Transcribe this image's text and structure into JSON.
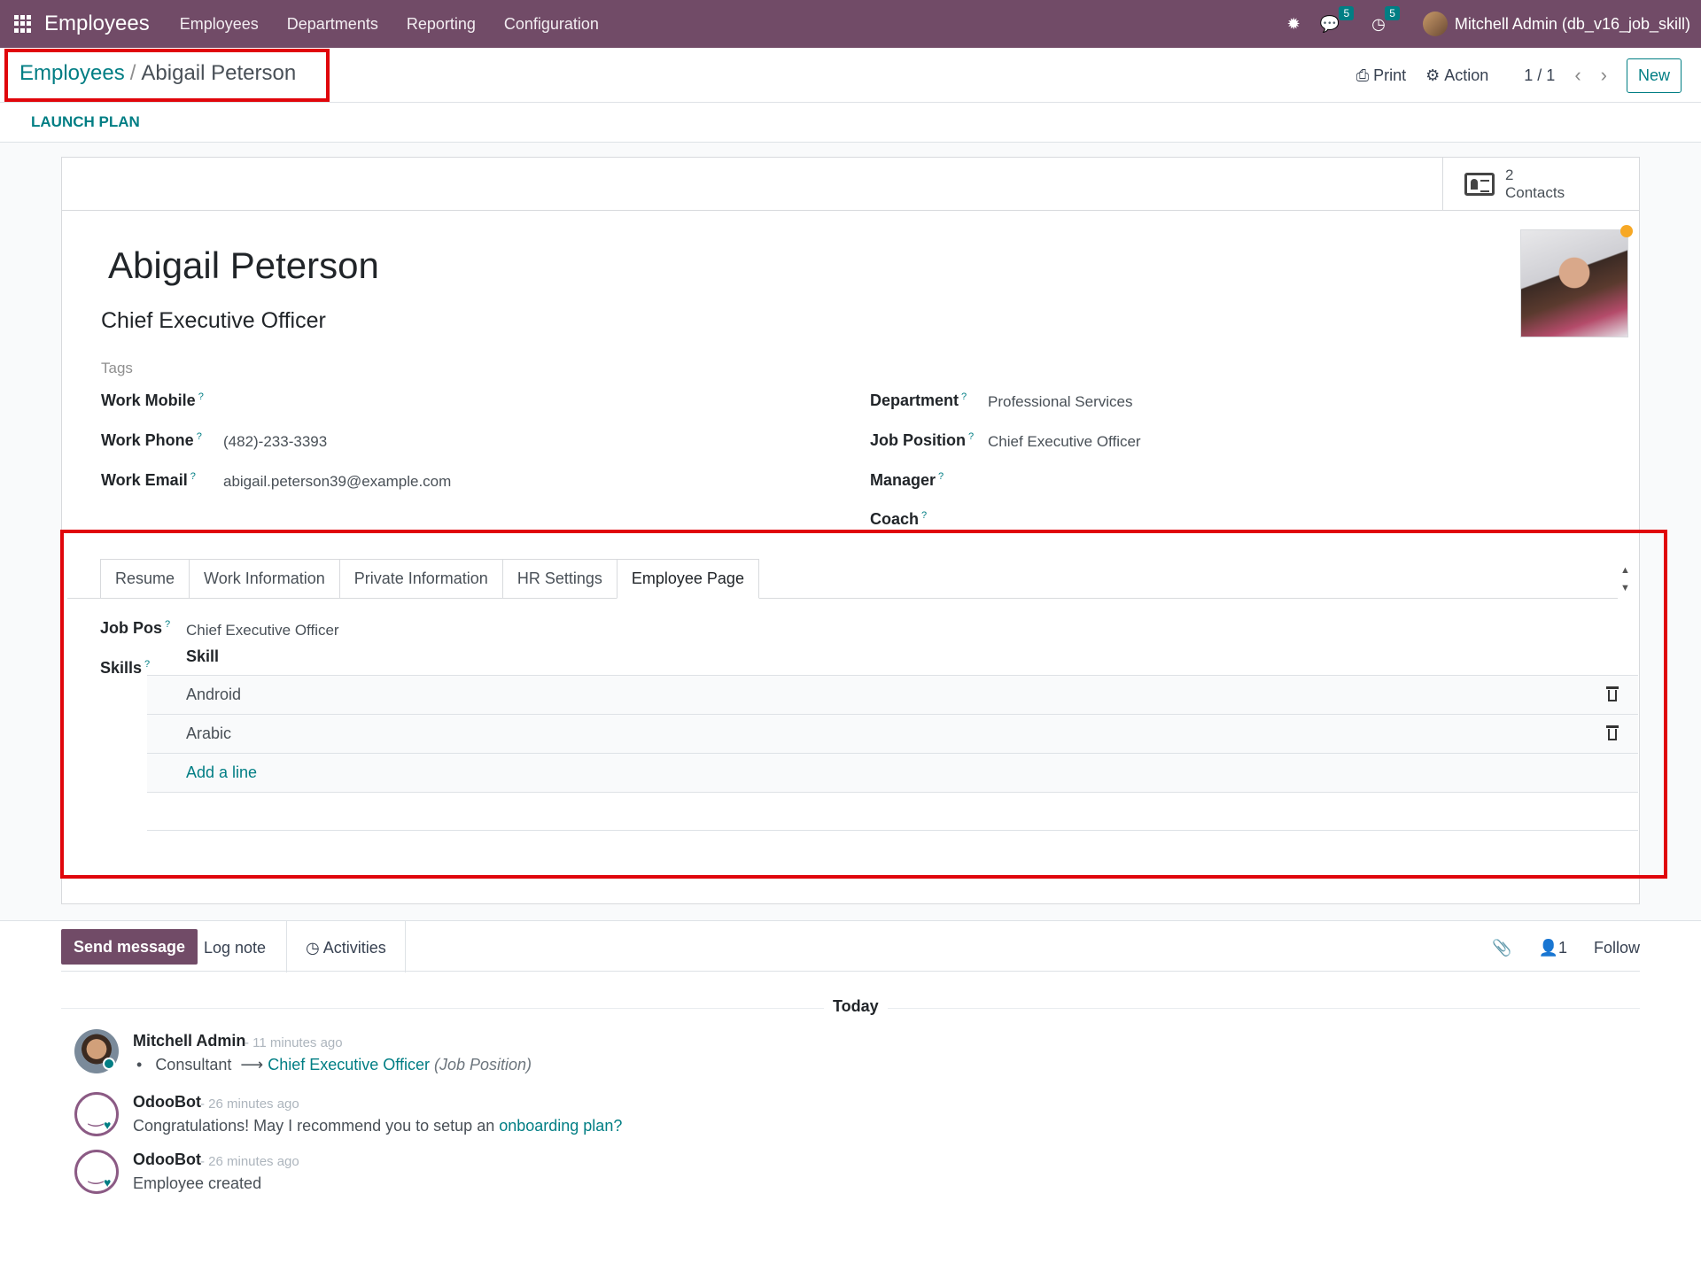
{
  "navbar": {
    "app_title": "Employees",
    "menu": [
      "Employees",
      "Departments",
      "Reporting",
      "Configuration"
    ],
    "messages_count": "5",
    "activities_count": "5",
    "user": "Mitchell Admin (db_v16_job_skill)",
    "bg_color": "#714b67"
  },
  "breadcrumb": {
    "parent": "Employees",
    "sep": "/",
    "current": "Abigail Peterson"
  },
  "control": {
    "print": "Print",
    "action": "Action",
    "pager": "1 / 1",
    "new": "New"
  },
  "statusbar": {
    "launch_plan": "LAUNCH PLAN"
  },
  "smart_button": {
    "count": "2",
    "label": "Contacts"
  },
  "employee": {
    "name": "Abigail Peterson",
    "job_title": "Chief Executive Officer",
    "tags_placeholder": "Tags"
  },
  "fields": {
    "work_mobile": {
      "label": "Work Mobile",
      "value": ""
    },
    "work_phone": {
      "label": "Work Phone",
      "value": "(482)-233-3393"
    },
    "work_email": {
      "label": "Work Email",
      "value": "abigail.peterson39@example.com"
    },
    "department": {
      "label": "Department",
      "value": "Professional Services"
    },
    "job_position": {
      "label": "Job Position",
      "value": "Chief Executive Officer"
    },
    "manager": {
      "label": "Manager",
      "value": ""
    },
    "coach": {
      "label": "Coach",
      "value": ""
    },
    "help": "?"
  },
  "tabs": [
    "Resume",
    "Work Information",
    "Private Information",
    "HR Settings",
    "Employee Page"
  ],
  "employee_page": {
    "job_pos_label": "Job Pos",
    "job_pos_value": "Chief Executive Officer",
    "skills_label": "Skills",
    "skill_header": "Skill",
    "skills": [
      "Android",
      "Arabic"
    ],
    "add_line": "Add a line"
  },
  "chatter": {
    "send_message": "Send message",
    "log_note": "Log note",
    "activities": "Activities",
    "followers": "1",
    "follow": "Follow",
    "today": "Today",
    "messages": [
      {
        "author": "Mitchell Admin",
        "time": "- 11 minutes ago",
        "old": "Consultant",
        "new": "Chief Executive Officer",
        "field": "(Job Position)"
      },
      {
        "author": "OdooBot",
        "time": "- 26 minutes ago",
        "text": "Congratulations! May I recommend you to setup an ",
        "link": "onboarding plan?"
      },
      {
        "author": "OdooBot",
        "time": "- 26 minutes ago",
        "text": "Employee created"
      }
    ]
  },
  "colors": {
    "accent": "#017e84",
    "highlight": "#e0060b",
    "status_dot": "#f7a825"
  }
}
